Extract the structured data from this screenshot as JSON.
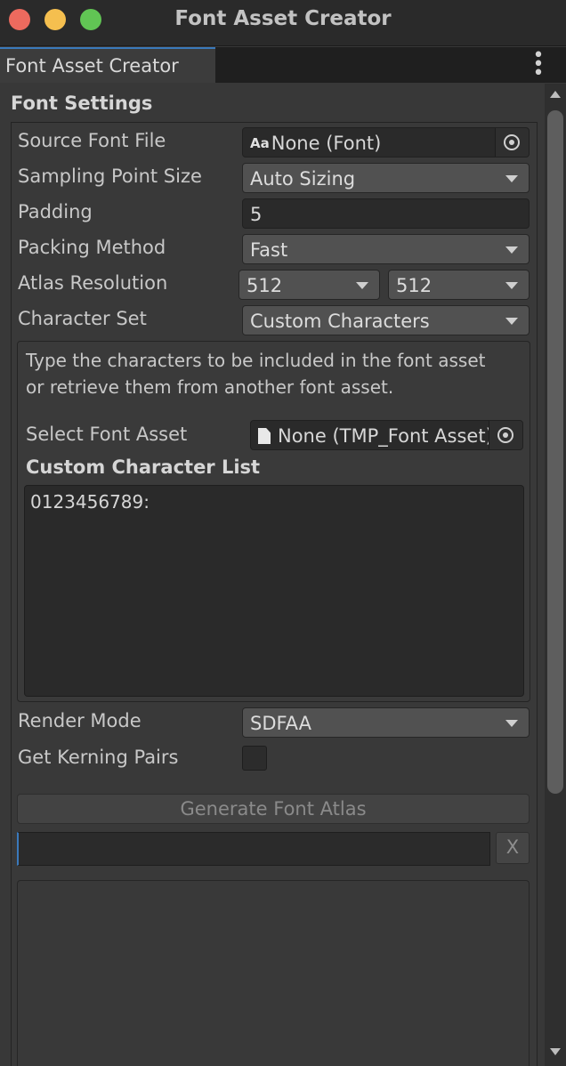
{
  "window": {
    "title": "Font Asset Creator"
  },
  "tab": {
    "label": "Font Asset Creator",
    "menu_icon": "kebab-menu-icon"
  },
  "section": {
    "title": "Font Settings"
  },
  "fields": {
    "source_font": {
      "label": "Source Font File",
      "value": "None (Font)",
      "icon": "font-aa-icon"
    },
    "sampling_point_size": {
      "label": "Sampling Point Size",
      "value": "Auto Sizing"
    },
    "padding": {
      "label": "Padding",
      "value": "5"
    },
    "packing_method": {
      "label": "Packing Method",
      "value": "Fast"
    },
    "atlas_resolution": {
      "label": "Atlas Resolution",
      "width": "512",
      "height": "512"
    },
    "character_set": {
      "label": "Character Set",
      "value": "Custom Characters"
    }
  },
  "custom_chars": {
    "help": "Type the characters to be included in the font asset or retrieve them from another font asset.",
    "select_label": "Select Font Asset",
    "select_value": "None (TMP_Font Asset)",
    "list_title": "Custom Character List",
    "list_value": "0123456789:"
  },
  "render_mode": {
    "label": "Render Mode",
    "value": "SDFAA"
  },
  "kerning": {
    "label": "Get Kerning Pairs",
    "checked": false
  },
  "generate_button": "Generate Font Atlas",
  "clear_button": "X",
  "colors": {
    "accent": "#3a79bb",
    "background": "#383838",
    "field": "#2a2a2a",
    "dropdown": "#515151"
  }
}
